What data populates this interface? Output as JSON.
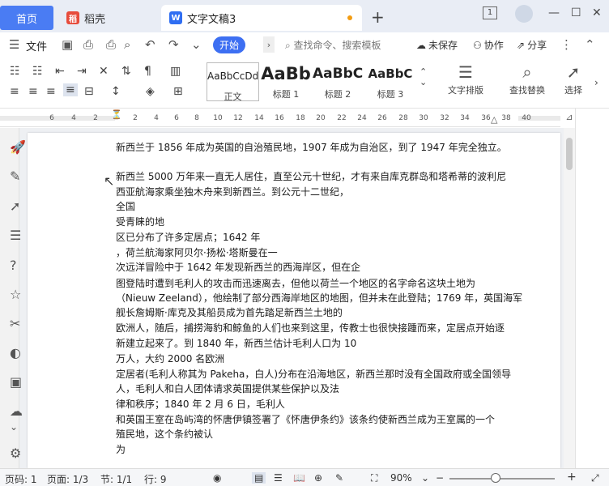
{
  "tabs": {
    "home": "首页",
    "shell": "稻壳",
    "doc": "文字文稿3",
    "new_tab": "+"
  },
  "window_controls": {
    "layout": "1",
    "minimize": "—",
    "maximize": "☐",
    "close": "✕"
  },
  "menu": {
    "file": "文件",
    "start": "开始",
    "search_placeholder": "查找命令、搜索模板",
    "unsaved": "未保存",
    "collaborate": "协作",
    "share": "分享"
  },
  "styles": [
    {
      "sample": "AaBbCcDd",
      "name": "正文"
    },
    {
      "sample": "AaBb",
      "name": "标题 1"
    },
    {
      "sample": "AaBbC",
      "name": "标题 2"
    },
    {
      "sample": "AaBbC",
      "name": "标题 3"
    }
  ],
  "tools": {
    "layout": "文字排版",
    "find": "查找替换",
    "select": "选择"
  },
  "ruler_ticks": [
    "6",
    "4",
    "2",
    "2",
    "4",
    "6",
    "8",
    "10",
    "12",
    "14",
    "16",
    "18",
    "20",
    "22",
    "24",
    "26",
    "28",
    "30",
    "32",
    "34",
    "36",
    "38",
    "40"
  ],
  "document": {
    "lines": [
      "新西兰于 1856 年成为英国的自治殖民地，1907 年成为自治区，到了 1947 年完全独立。",
      "",
      "新西兰 5000 万年来一直无人居住，直至公元十世纪，才有来自库克群岛和塔希蒂的波利尼",
      "西亚航海家乘坐独木舟来到新西兰。到公元十二世纪，",
      "全国",
      "受青睐的地",
      "区已分布了许多定居点；1642 年",
      "，荷兰航海家阿贝尔·扬松·塔斯曼在一",
      "次远洋冒险中于 1642 年发现新西兰的西海岸区，但在企",
      "图登陆时遭到毛利人的攻击而迅速离去，但他以荷兰一个地区的名字命名这块土地为",
      "（Nieuw Zeeland），他绘制了部分西海岸地区的地图，但并未在此登陆；1769 年，英国海军",
      "舰长詹姆斯·库克及其船员成为首先踏足新西兰土地的",
      "欧洲人，随后，捕捞海豹和鲸鱼的人们也来到这里，传教士也很快接踵而来，定居点开始逐",
      "新建立起来了。到 1840 年，新西兰估计毛利人口为 10",
      "万人，大约 2000 名欧洲",
      "定居者(毛利人称其为 Pakeha，白人)分布在沿海地区，新西兰那时没有全国政府或全国领导",
      "人，毛利人和白人团体请求英国提供某些保护以及法",
      "律和秩序；1840 年 2 月 6 日，毛利人",
      "和英国王室在岛屿湾的怀唐伊镇签署了《怀唐伊条约》该条约使新西兰成为王室属的一个",
      "殖民地，这个条约被认",
      "为"
    ]
  },
  "status": {
    "page_code": "页码: 1",
    "pages": "页面: 1/3",
    "section": "节: 1/1",
    "row": "行: 9",
    "zoom": "90%",
    "zoom_minus": "−",
    "zoom_plus": "+"
  }
}
